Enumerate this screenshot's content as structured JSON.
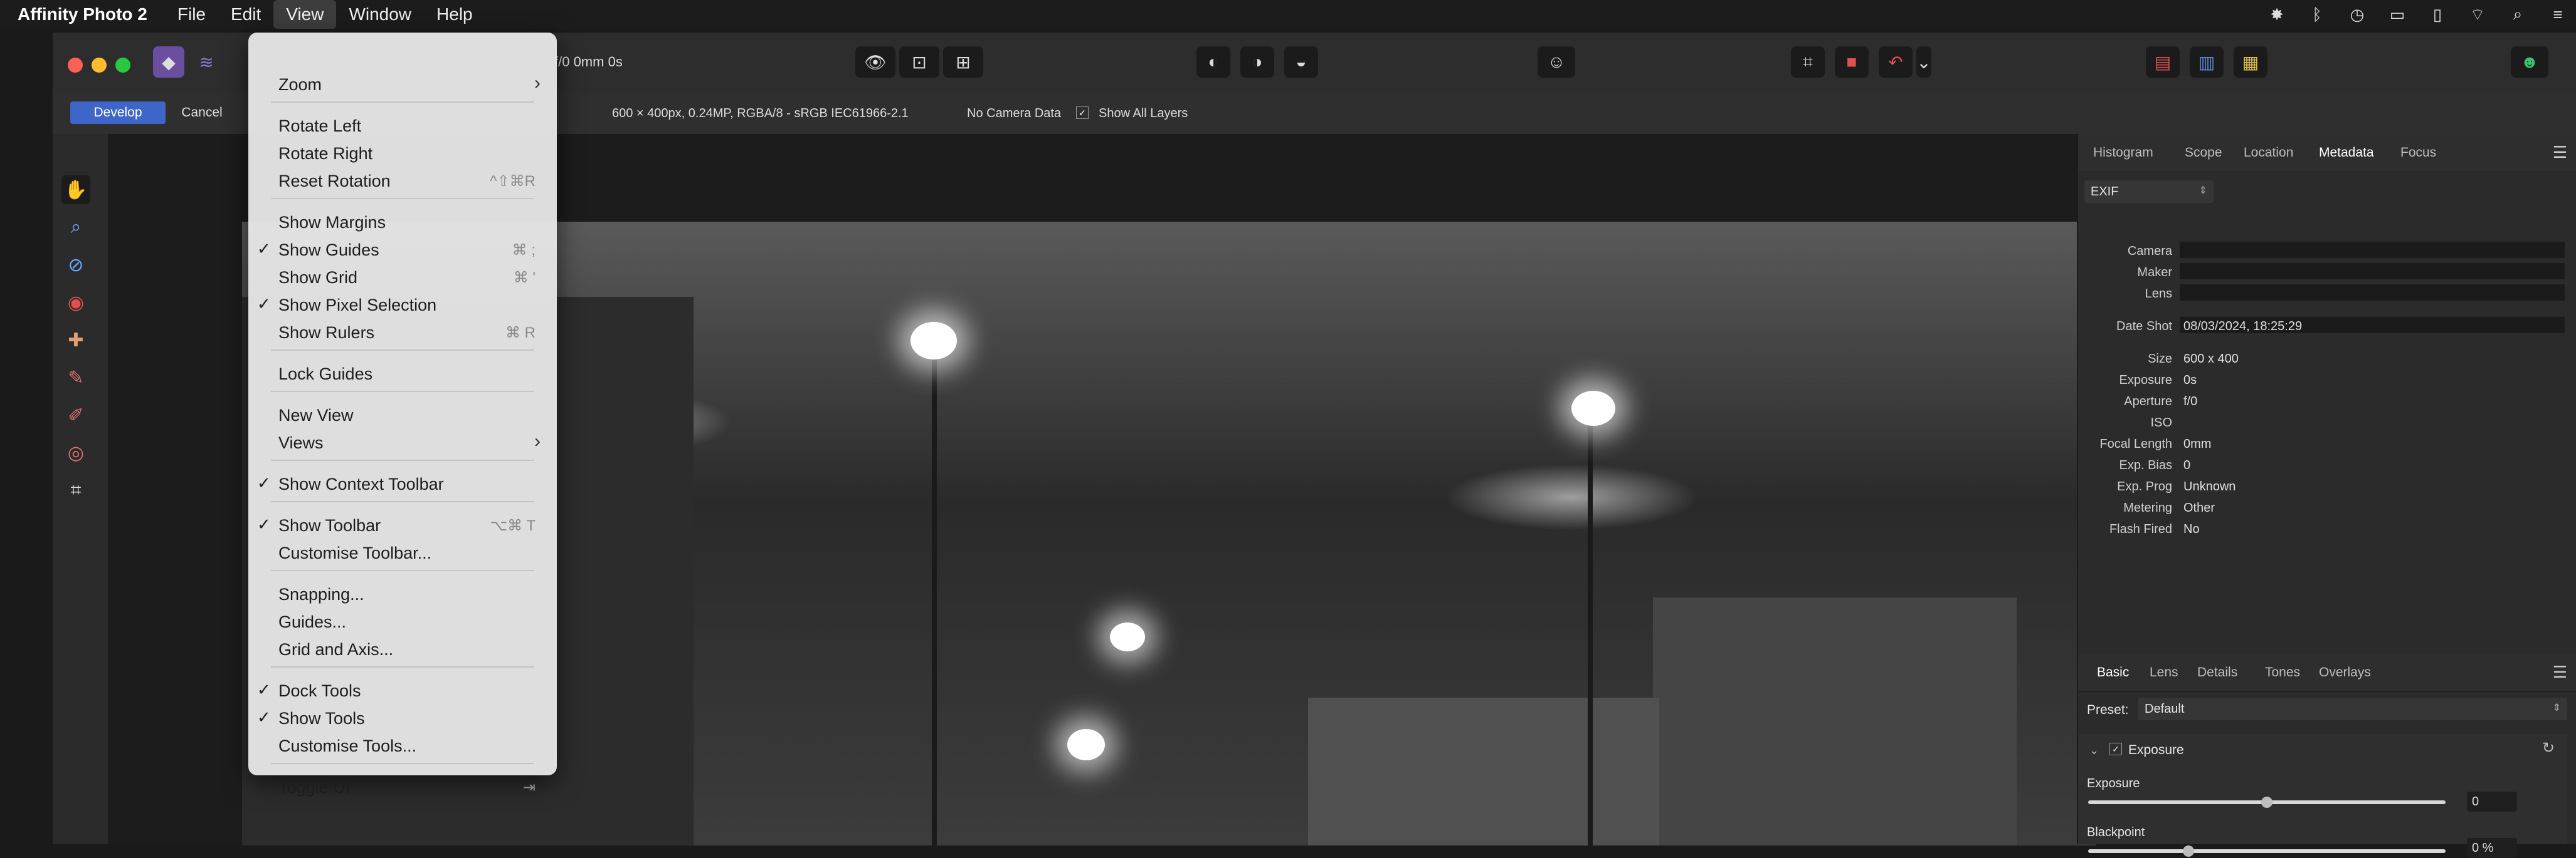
{
  "menubar": {
    "app_name": "Affinity Photo 2",
    "items": [
      "File",
      "Edit",
      "View",
      "Window",
      "Help"
    ],
    "active": "View"
  },
  "titlebar": {
    "doc_info": "f/0 0mm 0s"
  },
  "context_toolbar": {
    "develop_label": "Develop",
    "cancel_label": "Cancel",
    "image_info": "600 × 400px, 0.24MP, RGBA/8 - sRGB IEC61966-2.1",
    "camera_data": "No Camera Data",
    "show_all_layers": "Show All Layers"
  },
  "view_menu": {
    "items": [
      {
        "label": "Zoom",
        "submenu": true
      },
      {
        "label": "Rotate Left"
      },
      {
        "label": "Rotate Right"
      },
      {
        "label": "Reset Rotation",
        "shortcut": "^⇧⌘R"
      },
      {
        "label": "Show Margins"
      },
      {
        "label": "Show Guides",
        "checked": true,
        "shortcut": "⌘ ;"
      },
      {
        "label": "Show Grid",
        "shortcut": "⌘ '"
      },
      {
        "label": "Show Pixel Selection",
        "checked": true
      },
      {
        "label": "Show Rulers",
        "shortcut": "⌘ R"
      },
      {
        "label": "Lock Guides"
      },
      {
        "label": "New View"
      },
      {
        "label": "Views",
        "submenu": true
      },
      {
        "label": "Show Context Toolbar",
        "checked": true
      },
      {
        "label": "Show Toolbar",
        "checked": true,
        "shortcut": "⌥⌘ T"
      },
      {
        "label": "Customise Toolbar..."
      },
      {
        "label": "Snapping..."
      },
      {
        "label": "Guides..."
      },
      {
        "label": "Grid and Axis..."
      },
      {
        "label": "Dock Tools",
        "checked": true
      },
      {
        "label": "Show Tools",
        "checked": true
      },
      {
        "label": "Customise Tools..."
      },
      {
        "label": "Toggle UI",
        "shortcut": "⇥"
      }
    ]
  },
  "info_panel": {
    "tabs": [
      "Histogram",
      "Scope",
      "Location",
      "Metadata",
      "Focus"
    ],
    "selected_tab": "Metadata",
    "dropdown": "EXIF",
    "rows": [
      {
        "label": "Camera",
        "value": ""
      },
      {
        "label": "Maker",
        "value": ""
      },
      {
        "label": "Lens",
        "value": ""
      },
      {
        "label": "Date Shot",
        "value": "08/03/2024,  18:25:29"
      },
      {
        "label": "Size",
        "value": "600 x 400"
      },
      {
        "label": "Exposure",
        "value": "0s"
      },
      {
        "label": "Aperture",
        "value": "f/0"
      },
      {
        "label": "ISO",
        "value": ""
      },
      {
        "label": "Focal Length",
        "value": "0mm"
      },
      {
        "label": "Exp. Bias",
        "value": "0"
      },
      {
        "label": "Exp. Prog",
        "value": "Unknown"
      },
      {
        "label": "Metering",
        "value": "Other"
      },
      {
        "label": "Flash Fired",
        "value": "No"
      }
    ]
  },
  "develop_panel": {
    "tabs": [
      "Basic",
      "Lens",
      "Details",
      "Tones",
      "Overlays"
    ],
    "selected_tab": "Basic",
    "preset_label": "Preset:",
    "preset_value": "Default",
    "section_title": "Exposure",
    "exposure_label": "Exposure",
    "exposure_value": "0",
    "exposure_level": 0.5,
    "blackpoint_label": "Blackpoint",
    "blackpoint_value": "0 %",
    "blackpoint_level": 0.28
  },
  "colors": {
    "accent": "#4a6fd1",
    "menu_bg": "#e4e4e4"
  }
}
